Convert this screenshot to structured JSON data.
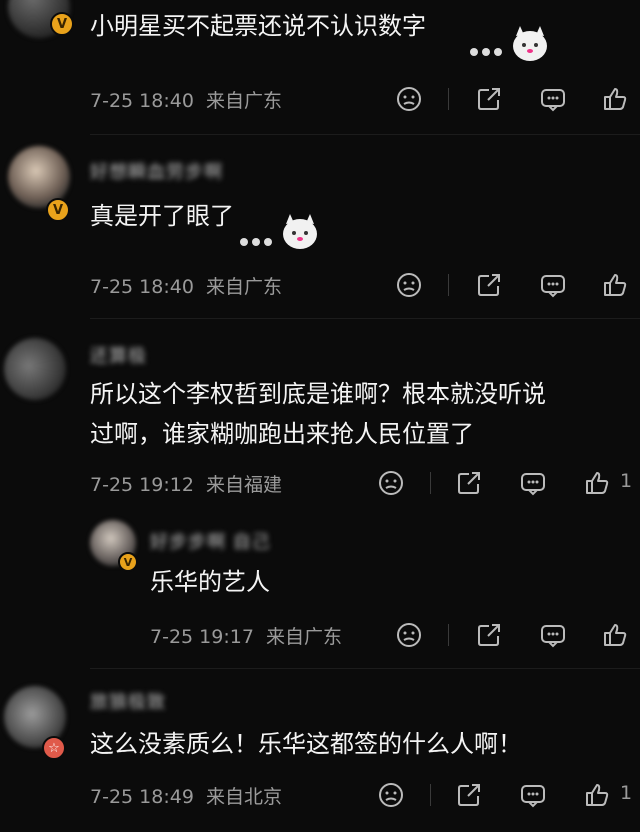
{
  "comments": [
    {
      "text_lines": [
        "小明星买不起票还说不认识数字"
      ],
      "time": "7-25 18:40",
      "location": "来自广东",
      "badge": "V",
      "has_sticker": true
    },
    {
      "username": "好想瞬血劳步啊",
      "text_lines": [
        "真是开了眼了"
      ],
      "time": "7-25 18:40",
      "location": "来自广东",
      "badge": "V",
      "has_sticker": true
    },
    {
      "username": "还算极",
      "text_lines": [
        "所以这个李权哲到底是谁啊？根本就没听说",
        "过啊，谁家糊咖跑出来抢人民位置了"
      ],
      "time": "7-25 19:12",
      "location": "来自福建",
      "like_count": "1"
    },
    {
      "username": "好步步啊 自己",
      "text_lines": [
        "乐华的艺人"
      ],
      "time": "7-25 19:17",
      "location": "来自广东",
      "badge": "V"
    },
    {
      "username": "旅狼极致",
      "text_lines": [
        "这么没素质么！乐华这都签的什么人啊！"
      ],
      "time": "7-25 18:49",
      "location": "来自北京",
      "badge": "☆",
      "like_count": "1"
    }
  ]
}
